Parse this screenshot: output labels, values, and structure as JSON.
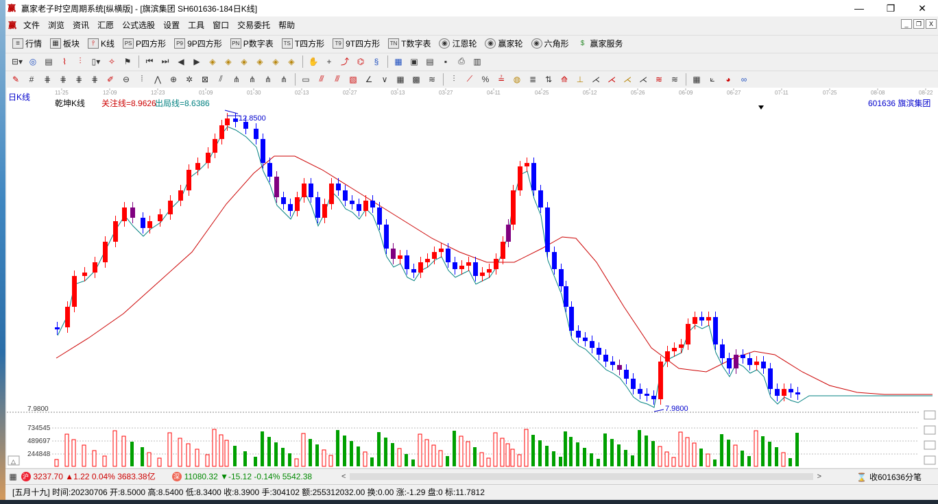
{
  "window": {
    "title": "赢家老子时空周期系统[纵横版] - [旗滨集团  SH601636-184日K线]",
    "controls": [
      "—",
      "❐",
      "✕"
    ]
  },
  "menu": {
    "logo": "赢",
    "items": [
      "文件",
      "浏览",
      "资讯",
      "汇愿",
      "公式选股",
      "设置",
      "工具",
      "窗口",
      "交易委托",
      "帮助"
    ],
    "mdi": [
      "_",
      "❐",
      "X"
    ]
  },
  "toolbar1": {
    "items": [
      {
        "icon": "≡",
        "label": "行情"
      },
      {
        "icon": "▦",
        "label": "板块"
      },
      {
        "icon": "⫯",
        "label": "K线"
      },
      {
        "icon": "PS",
        "label": "P四方形"
      },
      {
        "icon": "P9",
        "label": "9P四方形"
      },
      {
        "icon": "PN",
        "label": "P数字表"
      },
      {
        "icon": "TS",
        "label": "T四方形"
      },
      {
        "icon": "T9",
        "label": "9T四方形"
      },
      {
        "icon": "TN",
        "label": "T数字表"
      },
      {
        "icon": "◉",
        "label": "江恩轮"
      },
      {
        "icon": "◉",
        "label": "赢家轮"
      },
      {
        "icon": "◉",
        "label": "六角形"
      },
      {
        "icon": "$",
        "label": "赢家服务"
      }
    ]
  },
  "chart": {
    "period_label": "日K线",
    "indicator_name": "乾坤K线",
    "focus_line": "关注线=8.9626",
    "exit_line": "出局线=8.6386",
    "stock_info": "601636  旗滨集团",
    "high_label": "12.8500",
    "low_label": "7.9800",
    "price_axis_low": "7.9800",
    "volume_labels": [
      "734545",
      "489697",
      "244848"
    ],
    "date_ticks": [
      "11-25",
      "12-09",
      "12-23",
      "01-09",
      "01-30",
      "02-13",
      "02-27",
      "03-13",
      "03-27",
      "04-11",
      "04-25",
      "05-12",
      "05-26",
      "06-09",
      "06-27",
      "07-11",
      "07-25",
      "08-08",
      "08-22"
    ]
  },
  "status": {
    "index1": {
      "badge": "沪",
      "value": "3237.70",
      "change": "▲1.22",
      "pct": "0.04%",
      "amount": "3683.38亿"
    },
    "index2": {
      "badge": "深",
      "value": "11080.32",
      "change": "▼-15.12",
      "pct": "-0.14%",
      "amount": "5542.38"
    },
    "right": "收601636分笔"
  },
  "bottom": {
    "text": "[五月十九] 时间:20230706 开:8.5000 高:8.5400 低:8.3400 收:8.3900 手:304102 额:255312032.00 换:0.00 涨:-1.29 盘:0 标:11.7812"
  },
  "colors": {
    "up": "#ff0000",
    "down": "#0000ff",
    "neutral": "#800080",
    "ma_fast": "#008080",
    "ma_slow": "#cc0000",
    "volume_up": "#ff0000",
    "volume_down": "#00a000"
  }
}
